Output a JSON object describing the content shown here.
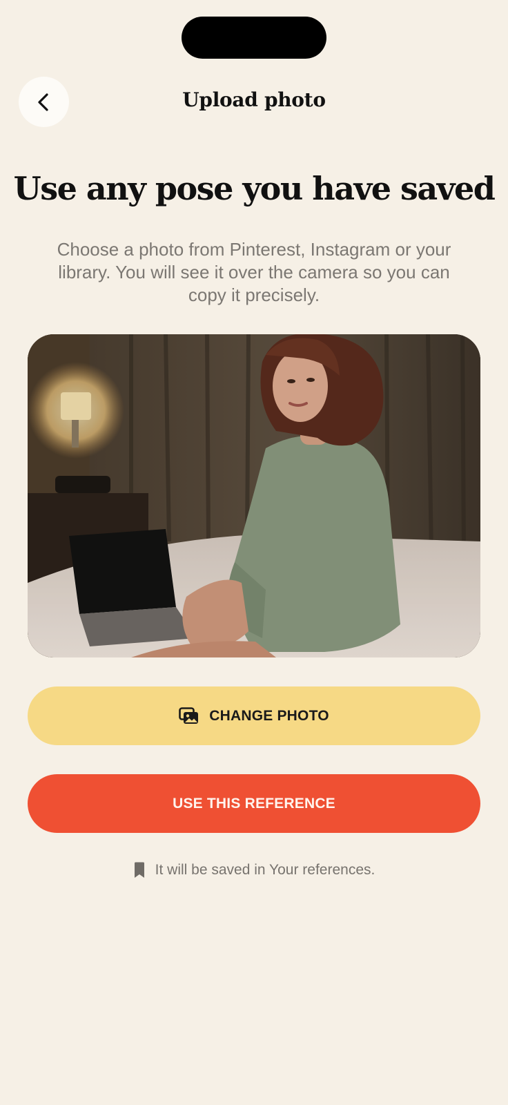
{
  "header": {
    "back_icon": "chevron-left-icon",
    "title": "Upload photo"
  },
  "main": {
    "headline": "Use any pose you have saved",
    "description": "Choose a photo from Pinterest, Instagram or your library. You will see it over the camera so you can copy it precisely.",
    "photo": {
      "alt": "Reference photo: woman in green t-shirt sitting on a bed next to a laptop"
    }
  },
  "actions": {
    "change_photo": {
      "icon": "images-icon",
      "label": "CHANGE PHOTO",
      "color": "#f6d985"
    },
    "use_reference": {
      "label": "USE THIS REFERENCE",
      "color": "#ef5033"
    }
  },
  "footer_note": {
    "icon": "bookmark-icon",
    "text": "It will be saved in Your references."
  },
  "colors": {
    "background": "#f6f0e6",
    "accent": "#ef5033"
  }
}
